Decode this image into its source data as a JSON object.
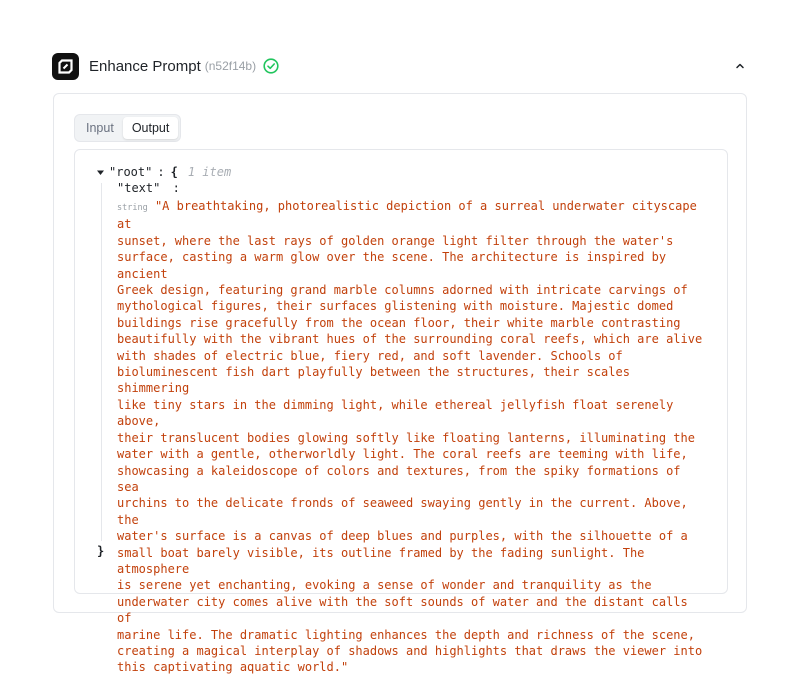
{
  "header": {
    "title": "Enhance Prompt",
    "node_id": "(n52f14b)",
    "status": "success"
  },
  "tabs": [
    {
      "label": "Input",
      "active": false
    },
    {
      "label": "Output",
      "active": true
    }
  ],
  "output": {
    "root_key": "\"root\"",
    "colon": ":",
    "open_brace": "{",
    "item_count": "1 item",
    "key": "\"text\"",
    "type": "string",
    "value_lines": [
      "\"A breathtaking, photorealistic depiction of a surreal underwater cityscape at",
      "sunset, where the last rays of golden orange light filter through the water's",
      "surface, casting a warm glow over the scene. The architecture is inspired by ancient",
      "Greek design, featuring grand marble columns adorned with intricate carvings of",
      "mythological figures, their surfaces glistening with moisture. Majestic domed",
      "buildings rise gracefully from the ocean floor, their white marble contrasting",
      "beautifully with the vibrant hues of the surrounding coral reefs, which are alive",
      "with shades of electric blue, fiery red, and soft lavender. Schools of",
      "bioluminescent fish dart playfully between the structures, their scales shimmering",
      "like tiny stars in the dimming light, while ethereal jellyfish float serenely above,",
      "their translucent bodies glowing softly like floating lanterns, illuminating the",
      "water with a gentle, otherworldly light. The coral reefs are teeming with life,",
      "showcasing a kaleidoscope of colors and textures, from the spiky formations of sea",
      "urchins to the delicate fronds of seaweed swaying gently in the current. Above, the",
      "water's surface is a canvas of deep blues and purples, with the silhouette of a",
      "small boat barely visible, its outline framed by the fading sunlight. The atmosphere",
      "is serene yet enchanting, evoking a sense of wonder and tranquility as the",
      "underwater city comes alive with the soft sounds of water and the distant calls of",
      "marine life. The dramatic lighting enhances the depth and richness of the scene,",
      "creating a magical interplay of shadows and highlights that draws the viewer into",
      "this captivating aquatic world.\""
    ],
    "close_brace": "}"
  },
  "colors": {
    "string_value": "#c2410c",
    "success": "#22c55e",
    "logo_bg": "#111111"
  },
  "icons": {
    "logo": "app-logo-icon",
    "status": "check-circle-icon",
    "collapse": "chevron-up-icon",
    "expand": "caret-down-icon"
  }
}
